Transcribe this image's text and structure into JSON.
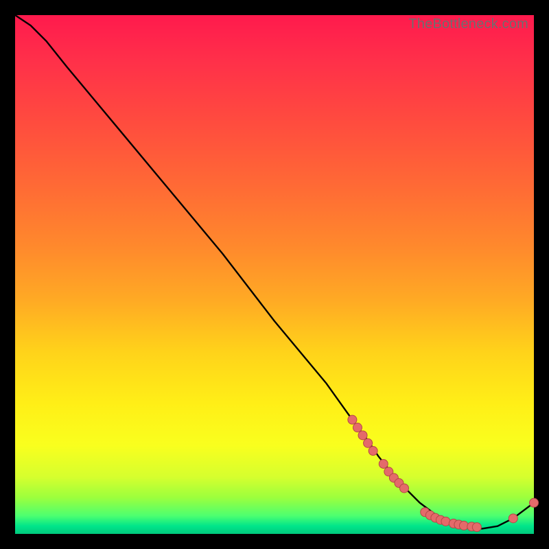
{
  "attribution": "TheBottleneck.com",
  "colors": {
    "background": "#000000",
    "curve": "#000000",
    "marker_fill": "#e46a6a",
    "marker_stroke": "#b54747",
    "gradient_stops": [
      "#ff1a4d",
      "#ff2e4a",
      "#ff4a3f",
      "#ff6a35",
      "#ff8a2c",
      "#ffaa24",
      "#ffd31a",
      "#ffef17",
      "#f9ff1e",
      "#d6ff2e",
      "#9cff3d",
      "#4dff70",
      "#00e58a",
      "#00c97d"
    ]
  },
  "chart_data": {
    "type": "line",
    "title": "",
    "xlabel": "",
    "ylabel": "",
    "xlim": [
      0,
      100
    ],
    "ylim": [
      0,
      100
    ],
    "grid": false,
    "legend": false,
    "annotations": [],
    "series": [
      {
        "name": "bottleneck-curve",
        "x": [
          0,
          3,
          6,
          10,
          15,
          20,
          30,
          40,
          50,
          60,
          65,
          68,
          70,
          74,
          78,
          82,
          86,
          90,
          93,
          96,
          100
        ],
        "y": [
          100,
          98,
          95,
          90,
          84,
          78,
          66,
          54,
          41,
          29,
          22,
          18,
          15,
          10,
          6,
          3,
          1.5,
          1,
          1.5,
          3,
          6
        ]
      }
    ],
    "markers": [
      {
        "name": "cluster-a",
        "x": 65,
        "y": 22
      },
      {
        "name": "cluster-a",
        "x": 66,
        "y": 20.5
      },
      {
        "name": "cluster-a",
        "x": 67,
        "y": 19
      },
      {
        "name": "cluster-a",
        "x": 68,
        "y": 17.5
      },
      {
        "name": "cluster-a",
        "x": 69,
        "y": 16
      },
      {
        "name": "cluster-b",
        "x": 71,
        "y": 13.5
      },
      {
        "name": "cluster-b",
        "x": 72,
        "y": 12
      },
      {
        "name": "cluster-b",
        "x": 73,
        "y": 10.8
      },
      {
        "name": "cluster-b",
        "x": 74,
        "y": 9.8
      },
      {
        "name": "cluster-b",
        "x": 75,
        "y": 8.8
      },
      {
        "name": "cluster-c",
        "x": 79,
        "y": 4.2
      },
      {
        "name": "cluster-c",
        "x": 80,
        "y": 3.6
      },
      {
        "name": "cluster-c",
        "x": 81,
        "y": 3.1
      },
      {
        "name": "cluster-c",
        "x": 82,
        "y": 2.7
      },
      {
        "name": "cluster-c",
        "x": 83,
        "y": 2.4
      },
      {
        "name": "cluster-c",
        "x": 84.5,
        "y": 2.0
      },
      {
        "name": "cluster-c",
        "x": 85.5,
        "y": 1.8
      },
      {
        "name": "cluster-c",
        "x": 86.5,
        "y": 1.6
      },
      {
        "name": "cluster-c",
        "x": 88,
        "y": 1.4
      },
      {
        "name": "cluster-c",
        "x": 89,
        "y": 1.3
      },
      {
        "name": "cluster-d",
        "x": 96,
        "y": 3.0
      },
      {
        "name": "cluster-d",
        "x": 100,
        "y": 6.0
      }
    ]
  }
}
